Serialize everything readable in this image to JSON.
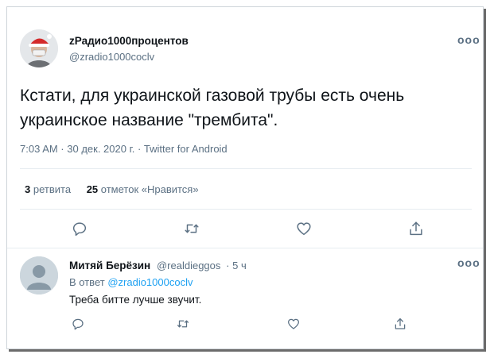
{
  "tweet": {
    "author_name": "zРадио1000процентов",
    "author_handle": "@zradio1000coclv",
    "text_line1": "Кстати, для украинской газовой трубы есть очень",
    "text_line2": "украинское название \"трембита\".",
    "timestamp": "7:03 AM · 30 дек. 2020 г. · Twitter for Android",
    "retweets_count": "3",
    "retweets_label": "ретвита",
    "likes_count": "25",
    "likes_label": "отметок «Нравится»",
    "more_label": "ooo"
  },
  "reply": {
    "author_name": "Митяй Берёзин",
    "author_handle": "@realdieggos",
    "time": "· 5 ч",
    "reply_to_prefix": "В ответ",
    "reply_to_handle": "@zradio1000coclv",
    "text": "Треба битте лучше звучит.",
    "more_label": "ooo"
  },
  "icons": {
    "reply": "reply-icon",
    "retweet": "retweet-icon",
    "like": "heart-icon",
    "share": "share-icon"
  },
  "colors": {
    "text": "#0f1419",
    "secondary": "#5b7083",
    "link": "#1da1f2",
    "divider": "#e6ecf0"
  }
}
